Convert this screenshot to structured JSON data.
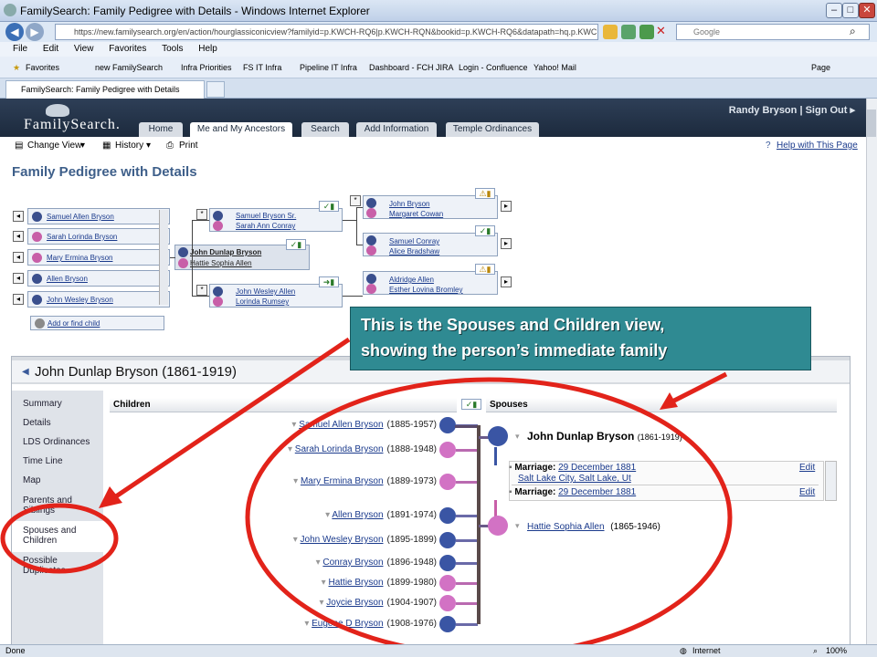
{
  "window": {
    "title": "FamilySearch: Family Pedigree with Details - Windows Internet Explorer"
  },
  "address": {
    "url": "https://new.familysearch.org/en/action/hourglassiconicview?familyid=p.KWCH-RQ6|p.KWCH-RQN&bookid=p.KWCH-RQ6&datapath=hq.p.KWCH-RQ6_p.KWCH",
    "search_placeholder": "Google"
  },
  "menu": [
    "File",
    "Edit",
    "View",
    "Favorites",
    "Tools",
    "Help"
  ],
  "favorites": {
    "label": "Favorites",
    "items": [
      "new FamilySearch",
      "Infra Priorities",
      "FS IT Infra",
      "Pipeline IT Infra",
      "Dashboard - FCH JIRA",
      "Login - Confluence",
      "Yahoo! Mail"
    ],
    "page": "Page"
  },
  "tab": {
    "title": "FamilySearch: Family Pedigree with Details"
  },
  "site": {
    "logo": "FamilySearch.",
    "user": "Randy Bryson",
    "sep": "|",
    "signout": "Sign Out",
    "tabs": [
      "Home",
      "Me and My Ancestors",
      "Search",
      "Add Information",
      "Temple Ordinances"
    ]
  },
  "toolbar": {
    "change_view": "Change View",
    "history": "History",
    "print": "Print",
    "help": "Help with This Page"
  },
  "page": {
    "title": "Family Pedigree with Details"
  },
  "pedigree": {
    "children": [
      "Samuel Allen Bryson",
      "Sarah Lorinda Bryson",
      "Mary Ermina Bryson",
      "Allen Bryson",
      "John Wesley Bryson"
    ],
    "add_child": "Add or find child",
    "focus": {
      "husband": "John Dunlap Bryson",
      "wife": "Hattie Sophia Allen"
    },
    "parents_h": {
      "husband": "Samuel Bryson Sr.",
      "wife": "Sarah Ann Conray"
    },
    "parents_w": {
      "husband": "John Wesley Allen",
      "wife": "Lorinda Rumsey"
    },
    "gp1": {
      "husband": "John Bryson",
      "wife": "Margaret Cowan"
    },
    "gp2": {
      "husband": "Samuel Conray",
      "wife": "Alice Bradshaw"
    },
    "gp3": {
      "husband": "Aldridge Allen",
      "wife": "Esther Lovina Bromley"
    }
  },
  "callout": {
    "line1": "This is the Spouses and Children view,",
    "line2": "showing the person’s immediate family"
  },
  "detail": {
    "title": "John Dunlap Bryson (1861-1919)",
    "nav": [
      "Summary",
      "Details",
      "LDS Ordinances",
      "Time Line",
      "Map",
      "Parents and Siblings",
      "Spouses and Children",
      "Possible Duplicates"
    ],
    "children_header": "Children",
    "spouses_header": "Spouses",
    "children": [
      {
        "name": "Samuel Allen Bryson",
        "years": "(1885-1957)",
        "sex": "m"
      },
      {
        "name": "Sarah Lorinda Bryson",
        "years": "(1888-1948)",
        "sex": "f"
      },
      {
        "name": "Mary Ermina Bryson",
        "years": "(1889-1973)",
        "sex": "f"
      },
      {
        "name": "Allen Bryson",
        "years": "(1891-1974)",
        "sex": "m"
      },
      {
        "name": "John Wesley Bryson",
        "years": "(1895-1899)",
        "sex": "m"
      },
      {
        "name": "Conray Bryson",
        "years": "(1896-1948)",
        "sex": "m"
      },
      {
        "name": "Hattie Bryson",
        "years": "(1899-1980)",
        "sex": "f"
      },
      {
        "name": "Joycie Bryson",
        "years": "(1904-1907)",
        "sex": "f"
      },
      {
        "name": "Eugene D Bryson",
        "years": "(1908-1976)",
        "sex": "m"
      }
    ],
    "person": {
      "name": "John Dunlap Bryson",
      "years": "(1861-1919)"
    },
    "marriage_label": "Marriage:",
    "marriage1_date": "29 December 1881",
    "marriage1_place": "Salt Lake City, Salt Lake, Ut",
    "marriage2_date": "29 December 1881",
    "edit": "Edit",
    "spouse": {
      "name": "Hattie Sophia Allen",
      "years": "(1865-1946)"
    }
  },
  "status": {
    "left": "Done",
    "zone": "Internet",
    "zoom": "100%"
  }
}
